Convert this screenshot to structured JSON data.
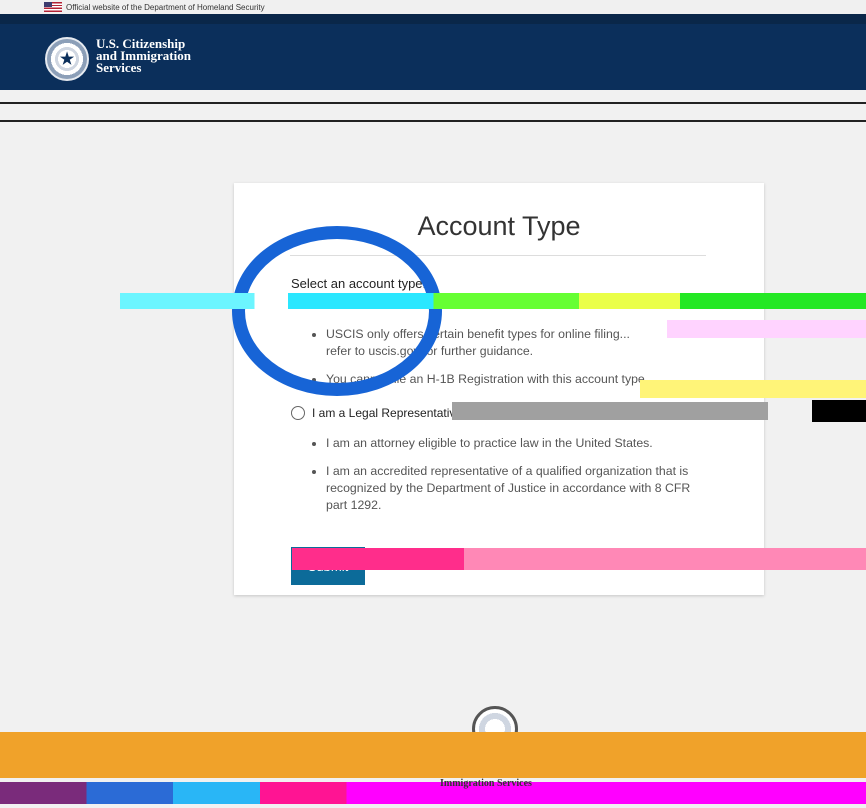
{
  "gov_banner": {
    "text": "Official website of the Department of Homeland Security"
  },
  "header": {
    "agency_line1": "U.S. Citizenship",
    "agency_line2": "and Immigration",
    "agency_line3": "Services"
  },
  "card": {
    "title": "Account Type",
    "select_label": "Select an account type:",
    "option_individual": {
      "bullets": [
        "USCIS only offers certain benefit types for online filing...",
        "refer to uscis.gov for further guidance.",
        "You cannot file an H-1B Registration with this account type."
      ]
    },
    "option_legal_rep": {
      "label": "I am a Legal Representative.",
      "bullets": [
        "I am an attorney eligible to practice law in the United States.",
        "I am an accredited representative of a qualified organization that is recognized by the Department of Justice in accordance with 8 CFR part 1292."
      ]
    },
    "next_button_label": "Submit"
  },
  "footer": {
    "agency_text": "Immigration Services"
  },
  "colors": {
    "header_bg": "#0b2f5b",
    "button_bg": "#0c6b99",
    "highlight_ring": "#1764d6",
    "footer_bar": "#f0a22a"
  },
  "icons": {
    "seal": "dhs-seal-icon",
    "flag": "us-flag-icon",
    "radio": "radio-unselected-icon"
  }
}
